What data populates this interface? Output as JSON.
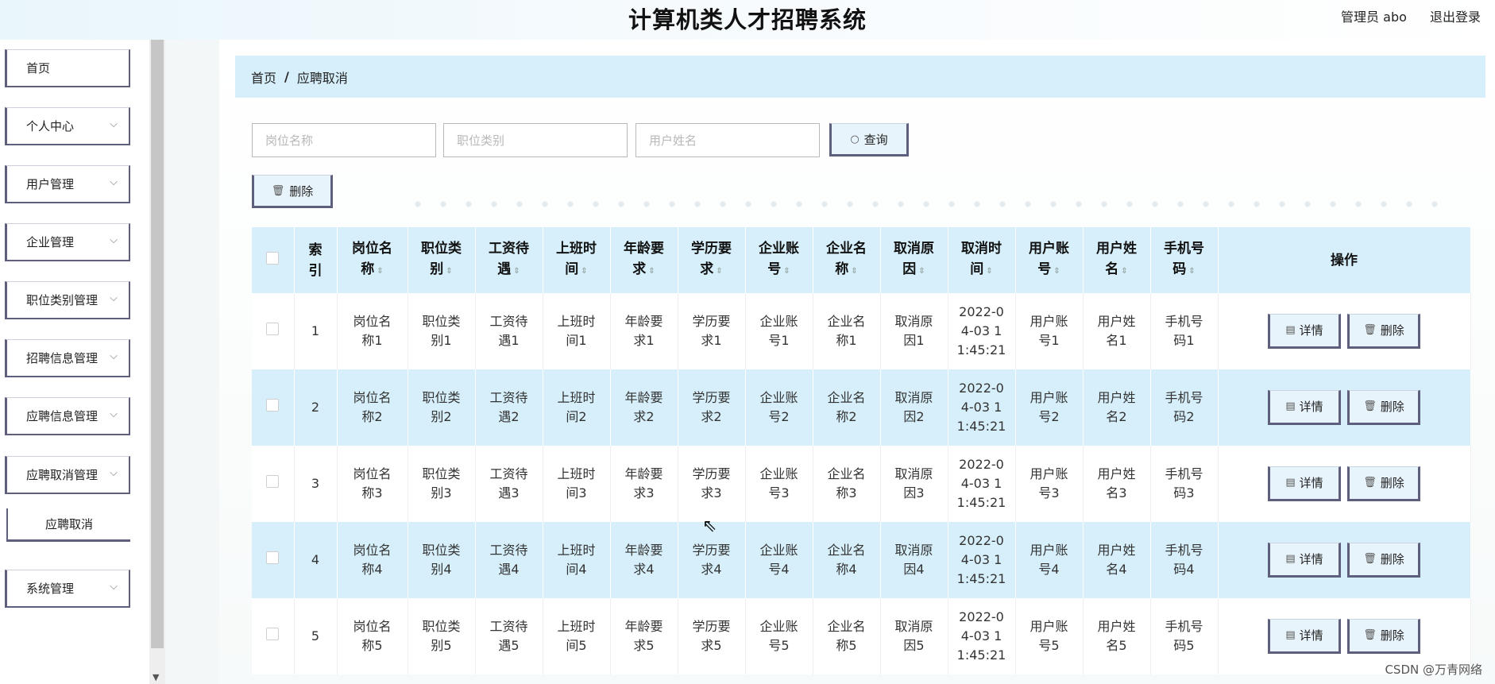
{
  "header": {
    "title": "计算机类人才招聘系统",
    "admin_label": "管理员 abo",
    "logout_label": "退出登录"
  },
  "sidebar": {
    "items": [
      {
        "label": "首页",
        "has_chevron": false
      },
      {
        "label": "个人中心",
        "has_chevron": true
      },
      {
        "label": "用户管理",
        "has_chevron": true
      },
      {
        "label": "企业管理",
        "has_chevron": true
      },
      {
        "label": "职位类别管理",
        "has_chevron": true
      },
      {
        "label": "招聘信息管理",
        "has_chevron": true
      },
      {
        "label": "应聘信息管理",
        "has_chevron": true
      },
      {
        "label": "应聘取消管理",
        "has_chevron": true
      },
      {
        "label": "系统管理",
        "has_chevron": true
      }
    ],
    "sub_item": "应聘取消",
    "chevron": "⌵"
  },
  "breadcrumb": {
    "home": "首页",
    "sep": "/",
    "current": "应聘取消"
  },
  "search": {
    "job_name_placeholder": "岗位名称",
    "job_category_placeholder": "职位类别",
    "user_name_placeholder": "用户姓名",
    "query_label": "查询",
    "search_icon": "search-icon"
  },
  "toolbar": {
    "delete_label": "删除",
    "trash_icon": "trash-icon"
  },
  "table": {
    "headers": [
      "索引",
      "岗位名称",
      "职位类别",
      "工资待遇",
      "上班时间",
      "年龄要求",
      "学历要求",
      "企业账号",
      "企业名称",
      "取消原因",
      "取消时间",
      "用户账号",
      "用户姓名",
      "手机号码",
      "操作"
    ],
    "header_lines": [
      [
        "索",
        "引"
      ],
      [
        "岗位名",
        "称"
      ],
      [
        "职位类",
        "别"
      ],
      [
        "工资待",
        "遇"
      ],
      [
        "上班时",
        "间"
      ],
      [
        "年龄要",
        "求"
      ],
      [
        "学历要",
        "求"
      ],
      [
        "企业账",
        "号"
      ],
      [
        "企业名",
        "称"
      ],
      [
        "取消原",
        "因"
      ],
      [
        "取消时",
        "间"
      ],
      [
        "用户账",
        "号"
      ],
      [
        "用户姓",
        "名"
      ],
      [
        "手机号",
        "码"
      ]
    ],
    "action_header": "操作",
    "detail_label": "详情",
    "delete_label": "删除",
    "rows": [
      {
        "index": "1",
        "cells": [
          [
            "岗位名",
            "称1"
          ],
          [
            "职位类",
            "别1"
          ],
          [
            "工资待",
            "遇1"
          ],
          [
            "上班时",
            "间1"
          ],
          [
            "年龄要",
            "求1"
          ],
          [
            "学历要",
            "求1"
          ],
          [
            "企业账",
            "号1"
          ],
          [
            "企业名",
            "称1"
          ],
          [
            "取消原",
            "因1"
          ],
          [
            "2022-0",
            "4-03 1",
            "1:45:21"
          ],
          [
            "用户账",
            "号1"
          ],
          [
            "用户姓",
            "名1"
          ],
          [
            "手机号",
            "码1"
          ]
        ]
      },
      {
        "index": "2",
        "cells": [
          [
            "岗位名",
            "称2"
          ],
          [
            "职位类",
            "别2"
          ],
          [
            "工资待",
            "遇2"
          ],
          [
            "上班时",
            "间2"
          ],
          [
            "年龄要",
            "求2"
          ],
          [
            "学历要",
            "求2"
          ],
          [
            "企业账",
            "号2"
          ],
          [
            "企业名",
            "称2"
          ],
          [
            "取消原",
            "因2"
          ],
          [
            "2022-0",
            "4-03 1",
            "1:45:21"
          ],
          [
            "用户账",
            "号2"
          ],
          [
            "用户姓",
            "名2"
          ],
          [
            "手机号",
            "码2"
          ]
        ]
      },
      {
        "index": "3",
        "cells": [
          [
            "岗位名",
            "称3"
          ],
          [
            "职位类",
            "别3"
          ],
          [
            "工资待",
            "遇3"
          ],
          [
            "上班时",
            "间3"
          ],
          [
            "年龄要",
            "求3"
          ],
          [
            "学历要",
            "求3"
          ],
          [
            "企业账",
            "号3"
          ],
          [
            "企业名",
            "称3"
          ],
          [
            "取消原",
            "因3"
          ],
          [
            "2022-0",
            "4-03 1",
            "1:45:21"
          ],
          [
            "用户账",
            "号3"
          ],
          [
            "用户姓",
            "名3"
          ],
          [
            "手机号",
            "码3"
          ]
        ]
      },
      {
        "index": "4",
        "cells": [
          [
            "岗位名",
            "称4"
          ],
          [
            "职位类",
            "别4"
          ],
          [
            "工资待",
            "遇4"
          ],
          [
            "上班时",
            "间4"
          ],
          [
            "年龄要",
            "求4"
          ],
          [
            "学历要",
            "求4"
          ],
          [
            "企业账",
            "号4"
          ],
          [
            "企业名",
            "称4"
          ],
          [
            "取消原",
            "因4"
          ],
          [
            "2022-0",
            "4-03 1",
            "1:45:21"
          ],
          [
            "用户账",
            "号4"
          ],
          [
            "用户姓",
            "名4"
          ],
          [
            "手机号",
            "码4"
          ]
        ]
      },
      {
        "index": "5",
        "cells": [
          [
            "岗位名",
            "称5"
          ],
          [
            "职位类",
            "别5"
          ],
          [
            "工资待",
            "遇5"
          ],
          [
            "上班时",
            "间5"
          ],
          [
            "年龄要",
            "求5"
          ],
          [
            "学历要",
            "求5"
          ],
          [
            "企业账",
            "号5"
          ],
          [
            "企业名",
            "称5"
          ],
          [
            "取消原",
            "因5"
          ],
          [
            "2022-0",
            "4-03 1",
            "1:45:21"
          ],
          [
            "用户账",
            "号5"
          ],
          [
            "用户姓",
            "名5"
          ],
          [
            "手机号",
            "码5"
          ]
        ]
      }
    ]
  },
  "watermark": "CSDN @万青网络",
  "colors": {
    "accent_light": "#d6effa",
    "button_border": "#5e5e7d"
  }
}
